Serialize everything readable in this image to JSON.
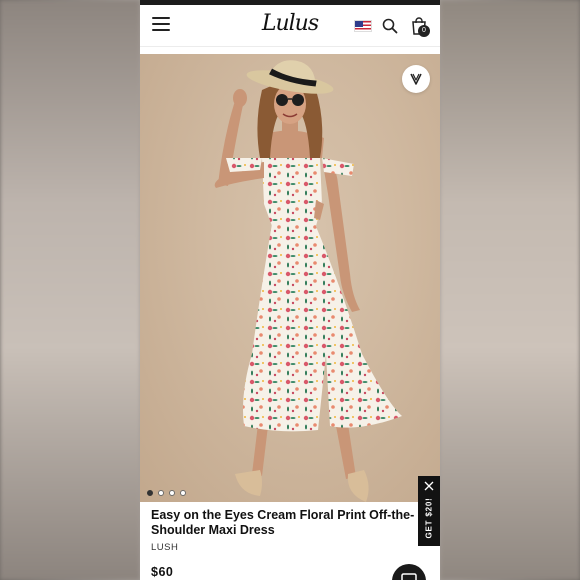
{
  "header": {
    "logo_text": "Lulus",
    "flag_label": "US flag",
    "icons": {
      "menu": "hamburger-menu-icon",
      "search": "search-icon",
      "bag": "shopping-bag-icon"
    },
    "bag_count": "0"
  },
  "gallery": {
    "favorite_icon": "heart-icon",
    "dot_count": 4,
    "active_dot": 0
  },
  "product": {
    "title": "Easy on the Eyes Cream Floral Print Off-the-Shoulder Maxi Dress",
    "brand": "LUSH",
    "price": "$60"
  },
  "promo": {
    "label": "GET $20!",
    "close_icon": "close-icon"
  },
  "chat": {
    "icon": "chat-icon"
  },
  "colors": {
    "header_bg": "#ffffff",
    "text": "#111111",
    "promo_bg": "#121212",
    "photo_bg": "#cfb89f"
  }
}
